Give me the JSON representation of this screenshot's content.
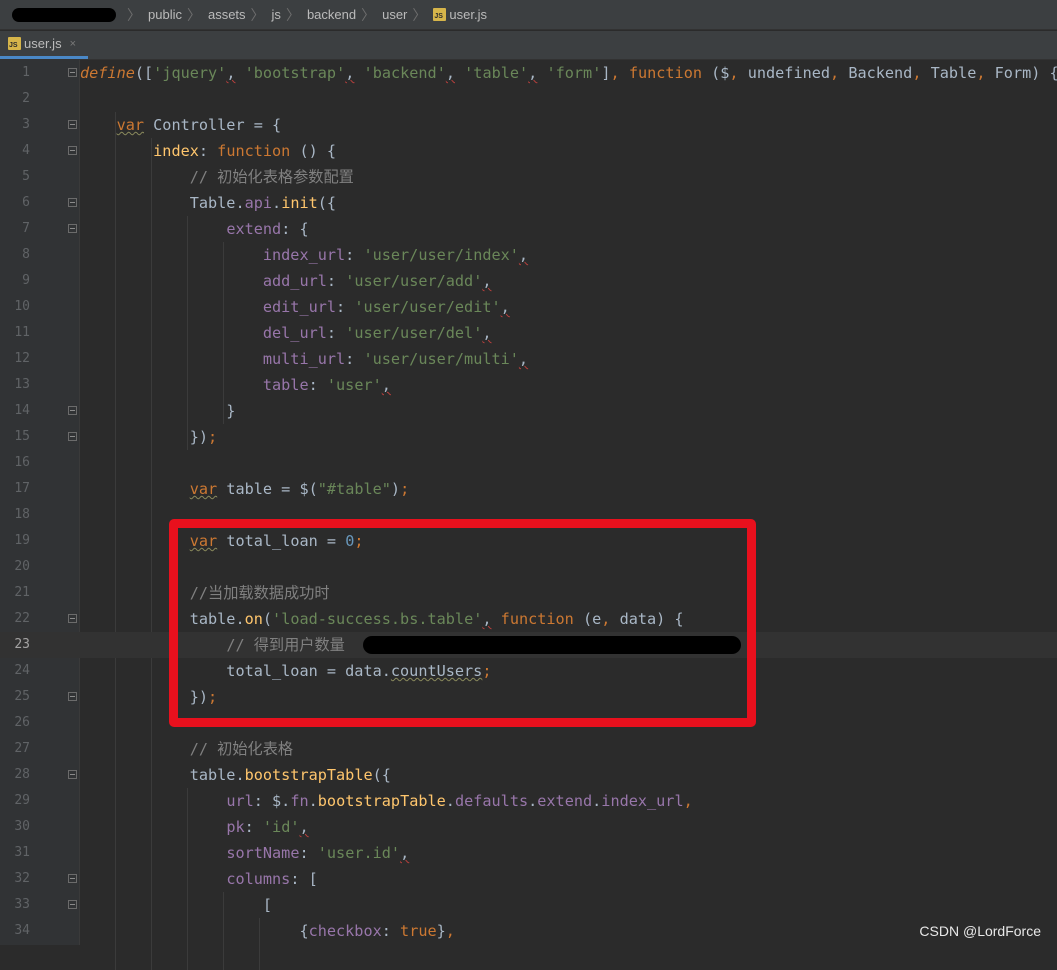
{
  "breadcrumb": {
    "items": [
      "public",
      "assets",
      "js",
      "backend",
      "user"
    ],
    "file": "user.js",
    "file_icon": "JS"
  },
  "tab": {
    "label": "user.js",
    "close": "×"
  },
  "current_line": 23,
  "code_lines": [
    {
      "n": "1",
      "html": "<span class=\"def\">define</span>([<span class=\"str\">'jquery'</span><span class=\"err\">,</span> <span class=\"str\">'bootstrap'</span><span class=\"err\">,</span> <span class=\"str\">'backend'</span><span class=\"err\">,</span> <span class=\"str\">'table'</span><span class=\"err\">,</span> <span class=\"str\">'form'</span>]<span class=\"kw\">,</span> <span class=\"kw\">function</span> ($<span class=\"kw\">,</span> undefined<span class=\"kw\">,</span> Backend<span class=\"kw\">,</span> Table<span class=\"kw\">,</span> Form) {"
    },
    {
      "n": "2",
      "html": ""
    },
    {
      "n": "3",
      "html": "    <span class=\"kw sq\">var</span> Controller = {"
    },
    {
      "n": "4",
      "html": "        <span class=\"fn\">index</span>: <span class=\"kw\">function</span> () {"
    },
    {
      "n": "5",
      "html": "            <span class=\"cmt\">// 初始化表格参数配置</span>"
    },
    {
      "n": "6",
      "html": "            Table.<span class=\"prop\">api</span>.<span class=\"fn\">init</span>({"
    },
    {
      "n": "7",
      "html": "                <span class=\"prop\">extend</span>: {"
    },
    {
      "n": "8",
      "html": "                    <span class=\"prop\">index_url</span>: <span class=\"str\">'user/user/index'</span><span class=\"err\">,</span>"
    },
    {
      "n": "9",
      "html": "                    <span class=\"prop\">add_url</span>: <span class=\"str\">'user/user/add'</span><span class=\"err\">,</span>"
    },
    {
      "n": "10",
      "html": "                    <span class=\"prop\">edit_url</span>: <span class=\"str\">'user/user/edit'</span><span class=\"err\">,</span>"
    },
    {
      "n": "11",
      "html": "                    <span class=\"prop\">del_url</span>: <span class=\"str\">'user/user/del'</span><span class=\"err\">,</span>"
    },
    {
      "n": "12",
      "html": "                    <span class=\"prop\">multi_url</span>: <span class=\"str\">'user/user/multi'</span><span class=\"err\">,</span>"
    },
    {
      "n": "13",
      "html": "                    <span class=\"prop\">table</span>: <span class=\"str\">'user'</span><span class=\"err\">,</span>"
    },
    {
      "n": "14",
      "html": "                }"
    },
    {
      "n": "15",
      "html": "            })<span class=\"kw\">;</span>"
    },
    {
      "n": "16",
      "html": ""
    },
    {
      "n": "17",
      "html": "            <span class=\"kw sq\">var</span> table = $(<span class=\"str\">\"#table\"</span>)<span class=\"kw\">;</span>"
    },
    {
      "n": "18",
      "html": ""
    },
    {
      "n": "19",
      "html": "            <span class=\"kw sq\">var</span> total_loan = <span class=\"num\">0</span><span class=\"kw\">;</span>"
    },
    {
      "n": "20",
      "html": ""
    },
    {
      "n": "21",
      "html": "            <span class=\"cmt\">//当加载数据成功时</span>"
    },
    {
      "n": "22",
      "html": "            table.<span class=\"fn\">on</span>(<span class=\"str\">'load-success.bs.table'</span><span class=\"err\">,</span> <span class=\"kw\">function</span> (e<span class=\"kw\">,</span> data) {"
    },
    {
      "n": "23",
      "html": "                <span class=\"cmt\">// 得到用户数量</span>"
    },
    {
      "n": "24",
      "html": "                total_loan = data.<span class=\"sq\">countUsers</span><span class=\"kw\">;</span>"
    },
    {
      "n": "25",
      "html": "            })<span class=\"kw\">;</span>"
    },
    {
      "n": "26",
      "html": ""
    },
    {
      "n": "27",
      "html": "            <span class=\"cmt\">// 初始化表格</span>"
    },
    {
      "n": "28",
      "html": "            table.<span class=\"fn\">bootstrapTable</span>({"
    },
    {
      "n": "29",
      "html": "                <span class=\"prop\">url</span>: $.<span class=\"prop\">fn</span>.<span class=\"fn\">bootstrapTable</span>.<span class=\"prop\">defaults</span>.<span class=\"prop\">extend</span>.<span class=\"prop\">index_url</span><span class=\"kw\">,</span>"
    },
    {
      "n": "30",
      "html": "                <span class=\"prop\">pk</span>: <span class=\"str\">'id'</span><span class=\"err\">,</span>"
    },
    {
      "n": "31",
      "html": "                <span class=\"prop\">sortName</span>: <span class=\"str\">'user.id'</span><span class=\"err\">,</span>"
    },
    {
      "n": "32",
      "html": "                <span class=\"prop\">columns</span>: ["
    },
    {
      "n": "33",
      "html": "                    ["
    },
    {
      "n": "34",
      "html": "                        {<span class=\"prop\">checkbox</span>: <span class=\"kw\">true</span>}<span class=\"kw\">,</span>"
    }
  ],
  "fold_lines": [
    1,
    3,
    4,
    6,
    7,
    14,
    15,
    22,
    25,
    28,
    32,
    33
  ],
  "watermark": "CSDN @LordForce"
}
